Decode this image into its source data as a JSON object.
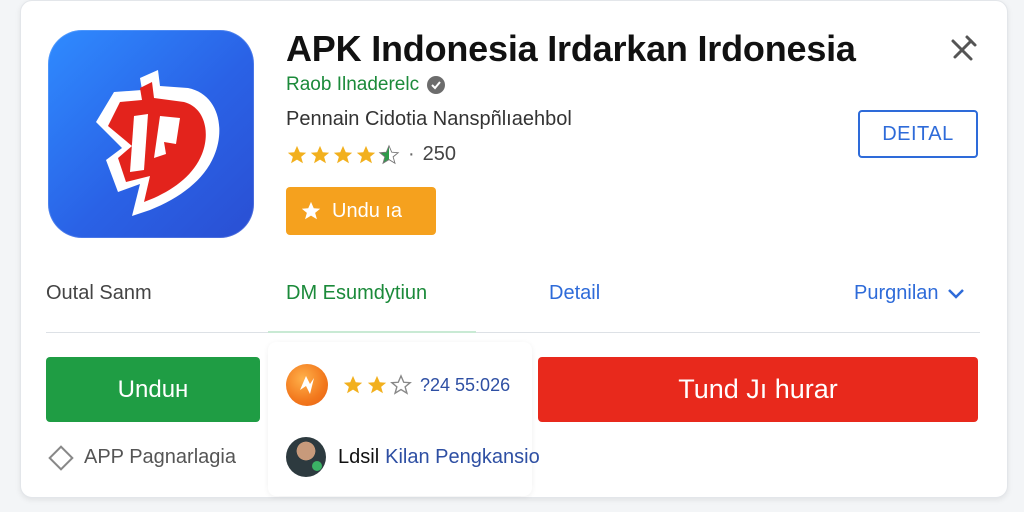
{
  "app": {
    "title": "APK Indonesia Irdarkan Irdonesia",
    "developer": "Raob Ilnaderelc",
    "subtitle": "Pennain Cidotia Nanspñlıaehbol",
    "rating_count": "250",
    "download_label": "Undu ıa",
    "detail_label": "DEITAL",
    "stars": 4.5
  },
  "tabs": [
    {
      "label": "Outal Sanm"
    },
    {
      "label": "DM Esumdytiun"
    },
    {
      "label": "Detail"
    },
    {
      "label": "Purgnilan"
    }
  ],
  "actions": {
    "primary_green": "Unduн",
    "primary_red": "Tund Jı hurar"
  },
  "mini": {
    "rating_text": "?24 55:026",
    "stars": 2.5
  },
  "footer": {
    "left_label": "APP Pagnarlagia",
    "name": "Ldsil",
    "role": "Kilan Pengkansio"
  },
  "colors": {
    "green": "#1f9d44",
    "red": "#e8291c",
    "orange": "#f5a11e",
    "blue": "#2e6bd9",
    "icon_blue": "#2a62e6"
  },
  "icons": [
    "close-icon",
    "verified-icon",
    "star-icon",
    "download-star-icon",
    "chevron-down-icon",
    "diamond-icon"
  ]
}
